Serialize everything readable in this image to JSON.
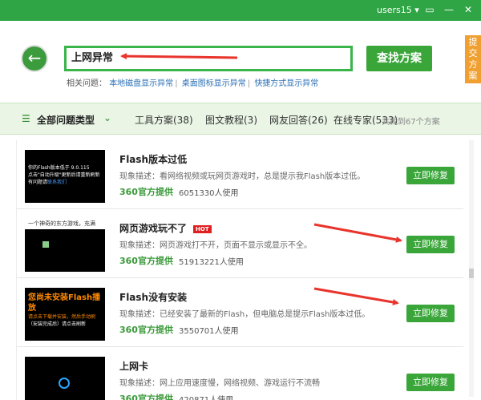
{
  "titlebar": {
    "user": "users15",
    "user_chevron": "▾",
    "icons": [
      "chat-icon",
      "minimize-icon",
      "close-icon"
    ]
  },
  "header": {
    "back_icon": "←",
    "search_value": "上网异常",
    "search_button": "查找方案",
    "related_label": "相关问题：",
    "related_links": [
      "本地磁盘显示异常",
      "桌面图标显示异常",
      "快捷方式显示异常"
    ],
    "side_tab": "提交方案"
  },
  "tabs": {
    "all": "全部问题类型",
    "items": [
      "工具方案(38)",
      "图文教程(3)",
      "网友回答(26)",
      "在线专家(533)"
    ],
    "found": "共找到67个方案"
  },
  "rows": [
    {
      "title": "Flash版本过低",
      "hot": "",
      "desc": "现象描述：看网络视频或玩网页游戏时，总是提示我Flash版本过低。",
      "source": "360官方提供",
      "users": "6051330人使用",
      "button": "立即修复",
      "thumb_lines": [
        "你的Flash版本低于 9.0.115",
        "点击\"自动升级\"更新后请重新刷新",
        "有问题请"
      ],
      "thumb_link": "联系我们"
    },
    {
      "title": "网页游戏玩不了",
      "hot": "HOT",
      "desc": "现象描述：网页游戏打不开，页面不显示或显示不全。",
      "source": "360官方提供",
      "users": "51913221人使用",
      "button": "立即修复",
      "thumb_banner": "一个神奇的东方游戏，充满"
    },
    {
      "title": "Flash没有安装",
      "hot": "",
      "desc": "现象描述：已经安装了最新的Flash，但电脑总是提示Flash版本过低。",
      "source": "360官方提供",
      "users": "3550701人使用",
      "button": "立即修复",
      "thumb_head": "您尚未安装Flash播放",
      "thumb_lines": [
        "请点击下载并安装，然后手动刷",
        "（安装完成后）请点击刷新"
      ]
    },
    {
      "title": "上网卡",
      "hot": "",
      "desc": "现象描述：网上应用速度慢，网络视频、游戏运行不流畅",
      "source": "360官方提供",
      "users": "420871人使用",
      "button": "立即修复"
    }
  ],
  "colors": {
    "brand_green": "#2fa545",
    "button_green": "#3aa63a",
    "annotation_red": "#e8342c",
    "side_orange": "#f0a030"
  }
}
